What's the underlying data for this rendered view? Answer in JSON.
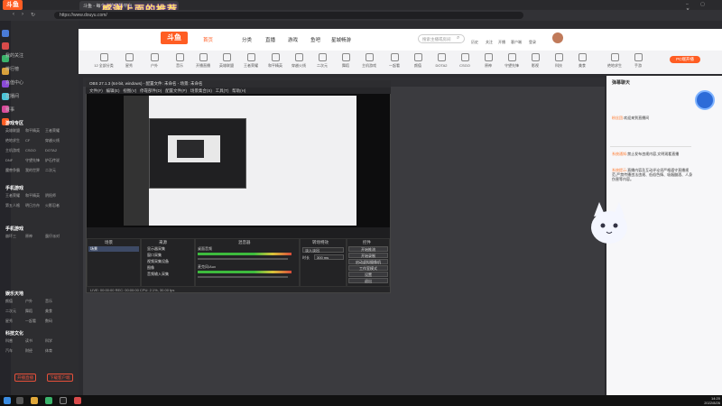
{
  "browser": {
    "logo": "斗鱼",
    "tab_title": "斗鱼 - 每个人的直播平台",
    "url": "https://www.douyu.com/",
    "banner_text": "感谢上面的推荐"
  },
  "colors": {
    "accent": "#ff5d23",
    "bg_dark": "#2b2b2f",
    "chat_bg": "#f7f7f9"
  },
  "sidebar": {
    "items": [
      "我的关注",
      "排行榜",
      "充值中心",
      "直播间",
      "赛事"
    ],
    "sections": [
      {
        "title": "游戏专区",
        "tags": [
          "英雄联盟",
          "和平精英",
          "王者荣耀",
          "绝地求生",
          "CF",
          "穿越火线",
          "主机游戏",
          "CSGO",
          "DOTA2",
          "DNF",
          "守望先锋",
          "炉石传说",
          "魔兽争霸",
          "我的世界",
          "二次元"
        ]
      },
      {
        "title": "手机游戏",
        "tags": [
          "王者荣耀",
          "和平精英",
          "阴阳师",
          "第五人格",
          "明日方舟",
          "火影忍者",
          "崩坏三",
          "原神",
          "蛋仔派对"
        ]
      },
      {
        "title": "娱乐天地",
        "tags": [
          "颜值",
          "户外",
          "音乐",
          "二次元",
          "舞蹈",
          "美食",
          "星秀",
          "一起看",
          "数码"
        ]
      },
      {
        "title": "科技文化",
        "tags": [
          "科普",
          "读书",
          "科学",
          "汽车",
          "财经",
          "体育"
        ]
      }
    ],
    "buttons": [
      "开播直播",
      "下载客户端"
    ]
  },
  "nav": {
    "logo": "斗鱼",
    "links": [
      "首页",
      "分类",
      "直播",
      "游戏",
      "鱼吧",
      "星城畅游"
    ],
    "search_placeholder": "搜索主播或房间",
    "icons": [
      "历史",
      "关注",
      "开播",
      "客户端",
      "登录"
    ]
  },
  "categories": [
    "12 全部分类",
    "星秀",
    "户外",
    "音乐",
    "开播直播",
    "英雄联盟",
    "王者荣耀",
    "和平精英",
    "穿越火线",
    "二次元",
    "舞蹈",
    "主机游戏",
    "一起看",
    "颜值",
    "DOTA2",
    "CSGO",
    "原神",
    "守望先锋",
    "影视",
    "科技",
    "美食",
    "绝地求生",
    "手游",
    "鱼吧",
    "商城"
  ],
  "room": {
    "tag_right": "PC端开播"
  },
  "chat": {
    "header": "弹幕聊天",
    "lines": [
      {
        "who": "粉丝团:",
        "text": "欢迎来到直播间"
      },
      {
        "who": "系统通知:",
        "text": "禁止发布违规内容,文明观看直播"
      },
      {
        "who": "系统提示:",
        "text": "直播内容及互动评论须严格遵守直播规范,严禁传播违法违规、低俗色情、吸烟酗酒、人身伤害等内容。"
      }
    ]
  },
  "obs": {
    "title": "OBS 27.1.3 (64-bit, windows) - 配置文件: 未命名 - 场景: 未命名",
    "menu": [
      "文件(F)",
      "编辑(E)",
      "视图(V)",
      "停靠部件(D)",
      "配置文件(P)",
      "场景集合(S)",
      "工具(T)",
      "帮助(H)"
    ],
    "docks": [
      "场景",
      "来源",
      "混音器",
      "转场特效",
      "控件"
    ],
    "scene": "场景",
    "sources": [
      "显示器采集",
      "窗口采集",
      "视频采集设备",
      "图像",
      "音频输入采集"
    ],
    "mixer": [
      "桌面音频",
      "麦克风/Aux"
    ],
    "transition": "淡入淡出",
    "duration_label": "时长",
    "duration": "300 ms",
    "controls": [
      "开始推流",
      "开始录制",
      "启动虚拟摄像机",
      "工作室模式",
      "设置",
      "退出"
    ],
    "status": "LIVE: 00:00:00   REC: 00:00:00   CPU: 2.1%, 30.00 fps"
  },
  "taskbar": {
    "time": "14:20",
    "date": "2022/8/26"
  }
}
